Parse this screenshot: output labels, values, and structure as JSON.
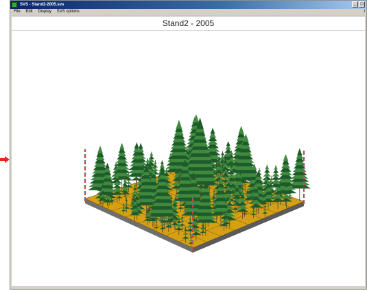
{
  "window": {
    "title": "SVS - Stand2-2005.svs",
    "minimize_label": "_",
    "maximize_label": "□",
    "menu_right_label": "i"
  },
  "menu": [
    "File",
    "Edit",
    "Display",
    "SVS options"
  ],
  "view": {
    "title": "Stand2 - 2005"
  },
  "colors": {
    "ground": "#d6a014",
    "ground_edge": "#6f6f6f",
    "tree_dark": "#1e5a2a",
    "tree_light": "#3f8a3e",
    "pole_red": "#e0431a",
    "pointer": "#e8271c"
  }
}
